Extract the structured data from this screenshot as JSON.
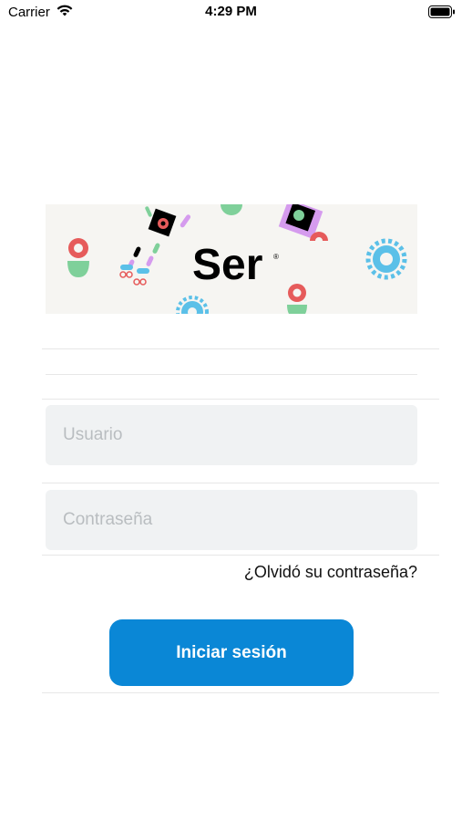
{
  "status_bar": {
    "carrier": "Carrier",
    "time": "4:29 PM"
  },
  "banner": {
    "logo_text": "Ser",
    "logo_mark": "®"
  },
  "login_form": {
    "username_placeholder": "Usuario",
    "password_placeholder": "Contraseña",
    "forgot_password": "¿Olvidó su contraseña?",
    "submit_label": "Iniciar sesión"
  },
  "colors": {
    "button": "#0a87d6",
    "field_background": "#f0f2f3",
    "banner_background": "#f6f5f2"
  },
  "icons": [
    "wifi-icon",
    "battery-icon"
  ]
}
